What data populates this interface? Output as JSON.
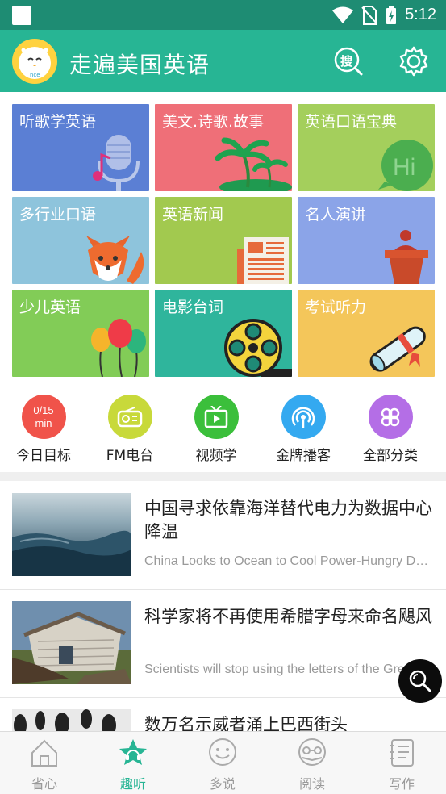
{
  "status_bar": {
    "time": "5:12"
  },
  "app": {
    "title": "走遍美国英语",
    "search_badge": "搜"
  },
  "tiles": [
    {
      "label": "听歌学英语",
      "color": "#5b7fd4",
      "icon": "microphone-music-icon"
    },
    {
      "label": "美文.诗歌.故事",
      "color": "#ef6f78",
      "icon": "palm-island-icon"
    },
    {
      "label": "英语口语宝典",
      "color": "#a4cf5c",
      "icon": "hi-bubble-icon"
    },
    {
      "label": "多行业口语",
      "color": "#8ec4dc",
      "icon": "fox-icon"
    },
    {
      "label": "英语新闻",
      "color": "#a2c94f",
      "icon": "newspaper-icon"
    },
    {
      "label": "名人演讲",
      "color": "#8ba4e8",
      "icon": "podium-speaker-icon"
    },
    {
      "label": "少儿英语",
      "color": "#82cc57",
      "icon": "balloons-icon"
    },
    {
      "label": "电影台词",
      "color": "#2fb59c",
      "icon": "film-reel-icon"
    },
    {
      "label": "考试听力",
      "color": "#f4c65a",
      "icon": "diploma-icon"
    }
  ],
  "shortcuts": [
    {
      "label": "今日目标",
      "color": "#f0534a",
      "badge_line1": "0/15",
      "badge_line2": "min",
      "icon": "timer-badge-icon"
    },
    {
      "label": "FM电台",
      "color": "#c8d93a",
      "icon": "radio-icon"
    },
    {
      "label": "视频学",
      "color": "#3bbf3b",
      "icon": "tv-play-icon"
    },
    {
      "label": "金牌播客",
      "color": "#34a9f0",
      "icon": "podcast-icon"
    },
    {
      "label": "全部分类",
      "color": "#b46ee6",
      "icon": "clover-grid-icon"
    }
  ],
  "articles": [
    {
      "title": "中国寻求依靠海洋替代电力为数据中心降温",
      "subtitle": "China Looks to Ocean to Cool Power-Hungry Data Centers",
      "thumb": "ocean-photo"
    },
    {
      "title": "科学家将不再使用希腊字母来命名飓风",
      "subtitle": "Scientists will stop using the letters of the Greek alphabet",
      "thumb": "hurricane-damage-photo"
    },
    {
      "title": "数万名示威者涌上巴西街头",
      "subtitle": "",
      "thumb": "protest-photo"
    }
  ],
  "tabbar": [
    {
      "label": "省心",
      "icon": "house-icon",
      "active": false
    },
    {
      "label": "趣听",
      "icon": "headphone-star-icon",
      "active": true
    },
    {
      "label": "多说",
      "icon": "smile-bubble-icon",
      "active": false
    },
    {
      "label": "阅读",
      "icon": "glasses-book-icon",
      "active": false
    },
    {
      "label": "写作",
      "icon": "notebook-icon",
      "active": false
    }
  ],
  "colors": {
    "primary": "#27b594",
    "status_bar": "#1e8c73",
    "fab": "#0c0c0c"
  }
}
